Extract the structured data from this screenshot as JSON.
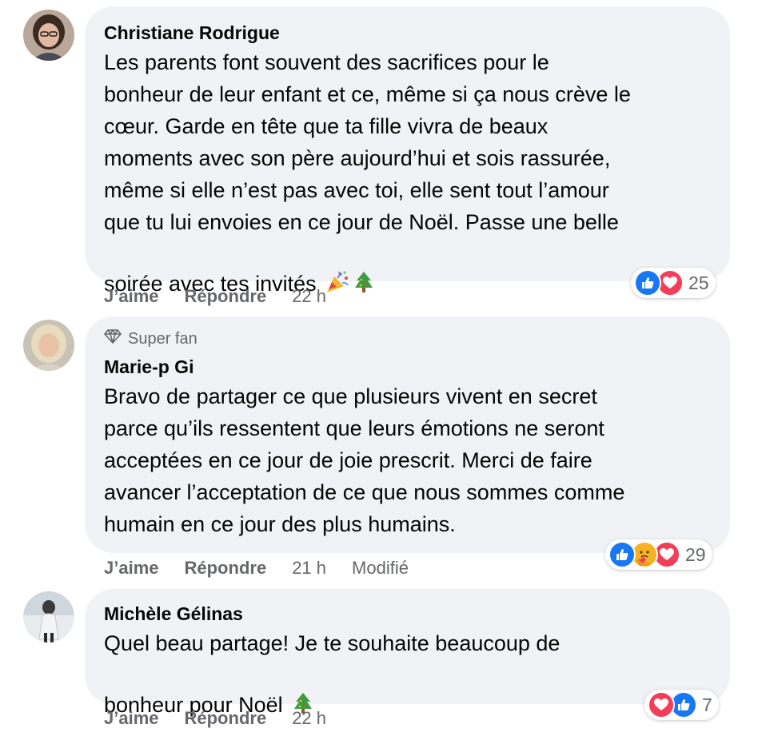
{
  "comments": [
    {
      "author": "Christiane Rodrigue",
      "text": "Les parents font souvent des sacrifices pour le\nbonheur de leur enfant et ce, même si ça nous crève le\ncœur. Garde en tête que ta fille vivra de beaux\nmoments avec son père aujourd’hui et sois rassurée,\nmême si elle n’est pas avec toi, elle sent tout l’amour\nque tu lui envoies en ce jour de Noël. Passe une belle\nsoirée avec tes invités",
      "emojis": [
        "party-popper-icon",
        "christmas-tree-icon"
      ],
      "actions": {
        "like": "J’aime",
        "reply": "Répondre",
        "time": "22 h"
      },
      "reactions": {
        "icons": [
          "like",
          "love"
        ],
        "count": "25"
      }
    },
    {
      "badge": "Super fan",
      "author": "Marie-p Gi",
      "text": "Bravo de partager ce que plusieurs vivent en secret\nparce qu’ils ressentent que leurs émotions ne seront\nacceptées en ce jour de joie prescrit. Merci de faire\navancer l’acceptation de ce que nous sommes comme\nhumain en ce jour des plus humains.",
      "actions": {
        "like": "J’aime",
        "reply": "Répondre",
        "time": "21 h",
        "edited": "Modifié"
      },
      "reactions": {
        "icons": [
          "like",
          "care",
          "love"
        ],
        "count": "29"
      }
    },
    {
      "author": "Michèle Gélinas",
      "text": "Quel beau partage! Je te souhaite beaucoup de\nbonheur pour Noël",
      "emojis": [
        "christmas-tree-icon"
      ],
      "actions": {
        "like": "J’aime",
        "reply": "Répondre",
        "time": "22 h"
      },
      "reactions": {
        "icons": [
          "love",
          "like"
        ],
        "count": "7"
      }
    }
  ],
  "colors": {
    "bubble": "#f0f2f5",
    "secondary_text": "#65676b",
    "like_blue": "#1877f2",
    "love_red": "#f33e58",
    "care_yellow": "#f7b125"
  }
}
